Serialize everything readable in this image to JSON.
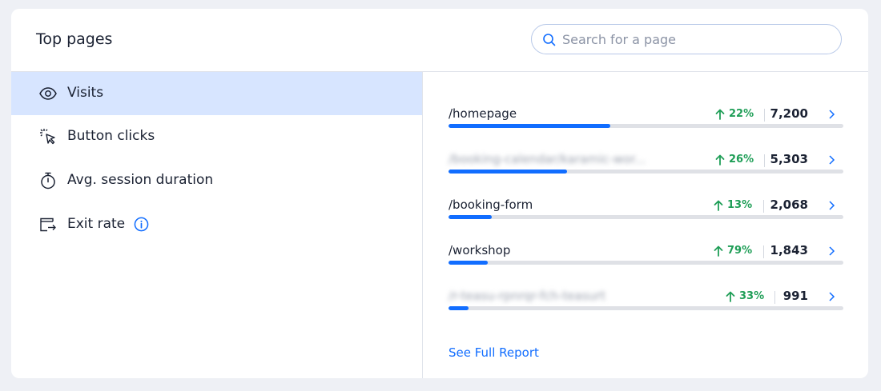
{
  "header": {
    "title": "Top pages",
    "search_placeholder": "Search for a page"
  },
  "metrics": [
    {
      "label": "Visits",
      "icon": "eye-icon",
      "active": true
    },
    {
      "label": "Button clicks",
      "icon": "cursor-click-icon",
      "active": false
    },
    {
      "label": "Avg. session duration",
      "icon": "stopwatch-icon",
      "active": false
    },
    {
      "label": "Exit rate",
      "icon": "exit-icon",
      "active": false,
      "info": "info-icon"
    }
  ],
  "pages": [
    {
      "path": "/homepage",
      "blurred": false,
      "delta": "22%",
      "count": "7,200",
      "share": 0.41
    },
    {
      "path": "/booking-calendar/karamic-wor...",
      "blurred": true,
      "delta": "26%",
      "count": "5,303",
      "share": 0.3
    },
    {
      "path": "/booking-form",
      "blurred": false,
      "delta": "13%",
      "count": "2,068",
      "share": 0.11
    },
    {
      "path": "/workshop",
      "blurred": false,
      "delta": "79%",
      "count": "1,843",
      "share": 0.1
    },
    {
      "path": "/r-teasu-rpnrqr-fch-teasurt",
      "blurred": true,
      "delta": "33%",
      "count": "991",
      "share": 0.05
    }
  ],
  "footer": {
    "link_label": "See Full Report"
  },
  "colors": {
    "accent": "#116dff",
    "positive": "#1f9e57",
    "active_row": "#d7e5ff"
  }
}
